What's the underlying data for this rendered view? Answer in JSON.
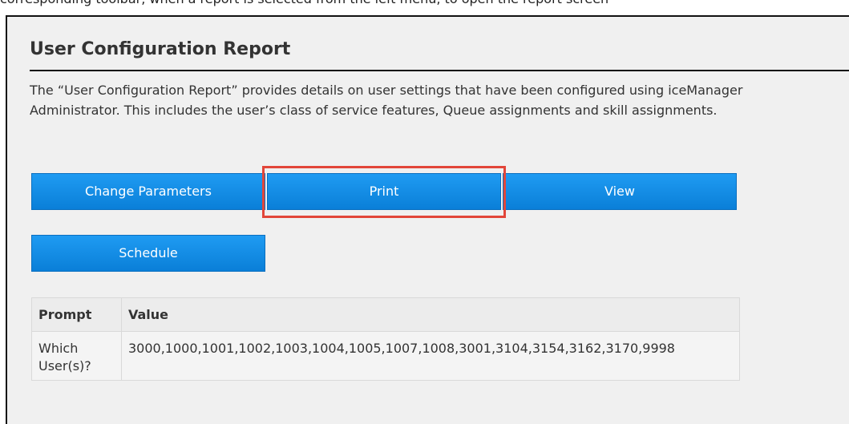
{
  "top_text": "corresponding toolbar, when a report is selected from the left menu, to open the report screen",
  "report": {
    "title": "User Configuration Report",
    "description": "The “User Configuration Report” provides details on user settings that have been configured using iceManager Administrator. This includes the user’s class of service features, Queue assignments and skill assignments."
  },
  "buttons": {
    "change_parameters": "Change Parameters",
    "print": "Print",
    "view": "View",
    "schedule": "Schedule"
  },
  "highlight_color": "#e2463a",
  "button_color": "#0f8ae6",
  "table": {
    "headers": [
      "Prompt",
      "Value"
    ],
    "rows": [
      {
        "prompt": "Which User(s)?",
        "value": "3000,1000,1001,1002,1003,1004,1005,1007,1008,3001,3104,3154,3162,3170,9998"
      }
    ]
  }
}
